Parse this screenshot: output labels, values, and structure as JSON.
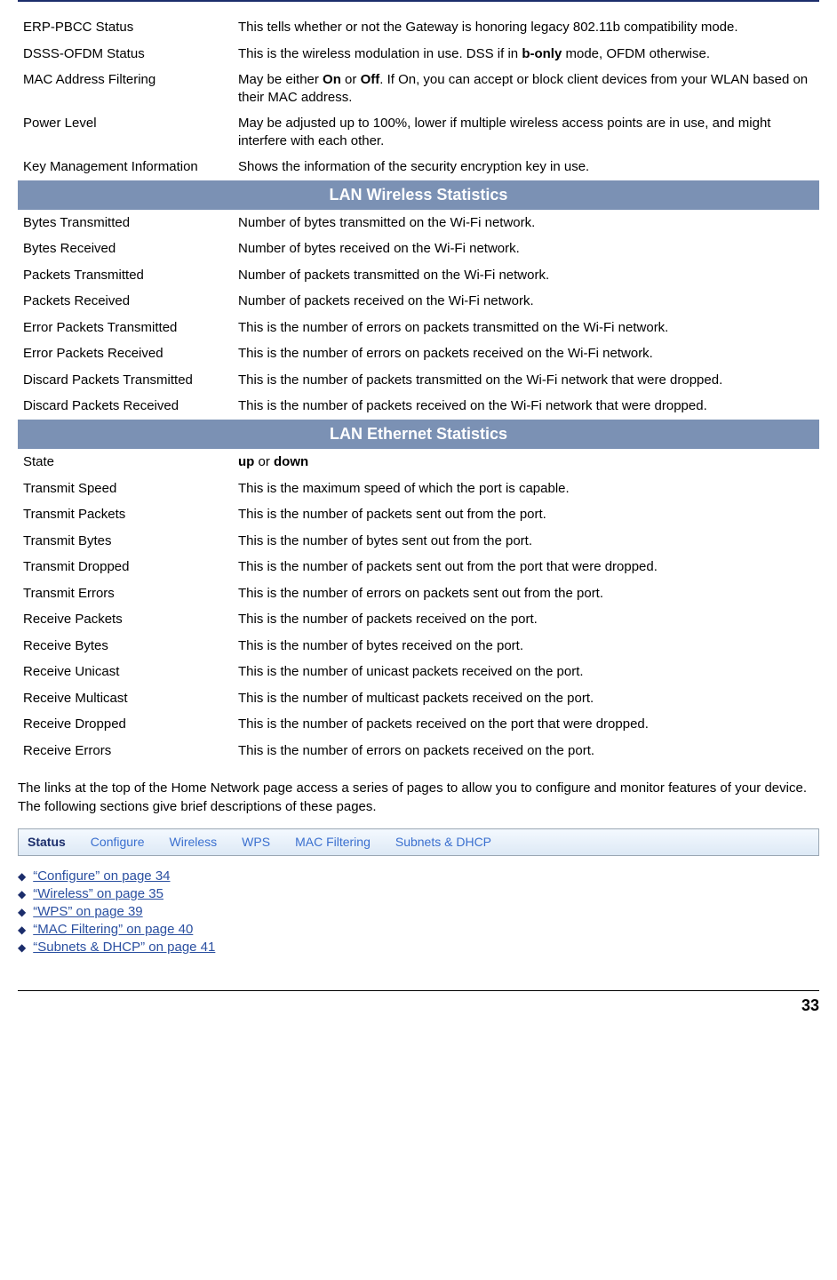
{
  "intro_rows": [
    {
      "term": "ERP-PBCC Status",
      "desc_html": "This tells whether or not the Gateway is honoring legacy 802.11b compatibility mode."
    },
    {
      "term": "DSSS-OFDM Status",
      "desc_html": "This is the wireless modulation in use.  DSS if in <span class=\"bld\">b-only</span> mode, OFDM otherwise."
    },
    {
      "term": "MAC Address Filtering",
      "desc_html": "May be either <span class=\"bld\">On</span> or <span class=\"bld\">Off</span>. If On, you can accept or block client devices from your WLAN based on their MAC address."
    },
    {
      "term": "Power Level",
      "desc_html": "May be adjusted up to 100%, lower if multiple wireless access points are in use, and might interfere with each other."
    },
    {
      "term": "Key Management Information",
      "desc_html": "Shows the information of the security encryption key in use."
    }
  ],
  "section1_title": "LAN Wireless Statistics",
  "section1_rows": [
    {
      "term": "Bytes Transmitted",
      "desc_html": "Number of bytes transmitted on the Wi-Fi network."
    },
    {
      "term": "Bytes Received",
      "desc_html": "Number of bytes received on the Wi-Fi network."
    },
    {
      "term": "Packets Transmitted",
      "desc_html": "Number of packets transmitted on the Wi-Fi network."
    },
    {
      "term": "Packets Received",
      "desc_html": "Number of packets received on the Wi-Fi network."
    },
    {
      "term": "Error Packets Transmitted",
      "desc_html": "This is the number of errors on packets transmitted on the Wi-Fi network."
    },
    {
      "term": "Error Packets Received",
      "desc_html": "This is the number of errors on packets received on the Wi-Fi network."
    },
    {
      "term": "Discard Packets Transmitted",
      "desc_html": "This is the number of packets transmitted on the Wi-Fi network that were dropped."
    },
    {
      "term": "Discard Packets Received",
      "desc_html": "This is the number of packets received on the Wi-Fi network that were dropped."
    }
  ],
  "section2_title": "LAN Ethernet Statistics",
  "section2_rows": [
    {
      "term": "State",
      "desc_html": "<span class=\"bld\">up</span> or <span class=\"bld\">down</span>"
    },
    {
      "term": "Transmit Speed",
      "desc_html": "This is the maximum speed of which the port is capable."
    },
    {
      "term": "Transmit Packets",
      "desc_html": "This is the number of packets sent out from the port."
    },
    {
      "term": "Transmit Bytes",
      "desc_html": "This is the number of bytes sent out from the port."
    },
    {
      "term": "Transmit Dropped",
      "desc_html": "This is the number of packets sent out from the port that were dropped."
    },
    {
      "term": "Transmit Errors",
      "desc_html": "This is the number of errors on packets sent out from the port."
    },
    {
      "term": "Receive Packets",
      "desc_html": "This is the number of packets received on the port."
    },
    {
      "term": "Receive Bytes",
      "desc_html": "This is the number of bytes received on the port."
    },
    {
      "term": "Receive Unicast",
      "desc_html": "This is the number of unicast packets received on the port."
    },
    {
      "term": "Receive Multicast",
      "desc_html": "This is the number of multicast packets received on the port."
    },
    {
      "term": "Receive Dropped",
      "desc_html": "This is the number of packets received on the port that were dropped."
    },
    {
      "term": "Receive Errors",
      "desc_html": "This is the number of errors on packets received on the port."
    }
  ],
  "paragraph": "The links at the top of the Home Network page access a series of pages to allow you to configure and monitor features of your device. The following sections give brief descriptions of these pages.",
  "tabs": {
    "items": [
      {
        "label": "Status",
        "active": true
      },
      {
        "label": "Configure",
        "active": false
      },
      {
        "label": "Wireless",
        "active": false
      },
      {
        "label": "WPS",
        "active": false
      },
      {
        "label": "MAC Filtering",
        "active": false
      },
      {
        "label": "Subnets & DHCP",
        "active": false
      }
    ]
  },
  "links": [
    "“Configure” on page 34",
    "“Wireless” on page 35",
    "“WPS” on page 39",
    "“MAC Filtering” on page 40",
    "“Subnets & DHCP” on page 41"
  ],
  "page_number": "33"
}
